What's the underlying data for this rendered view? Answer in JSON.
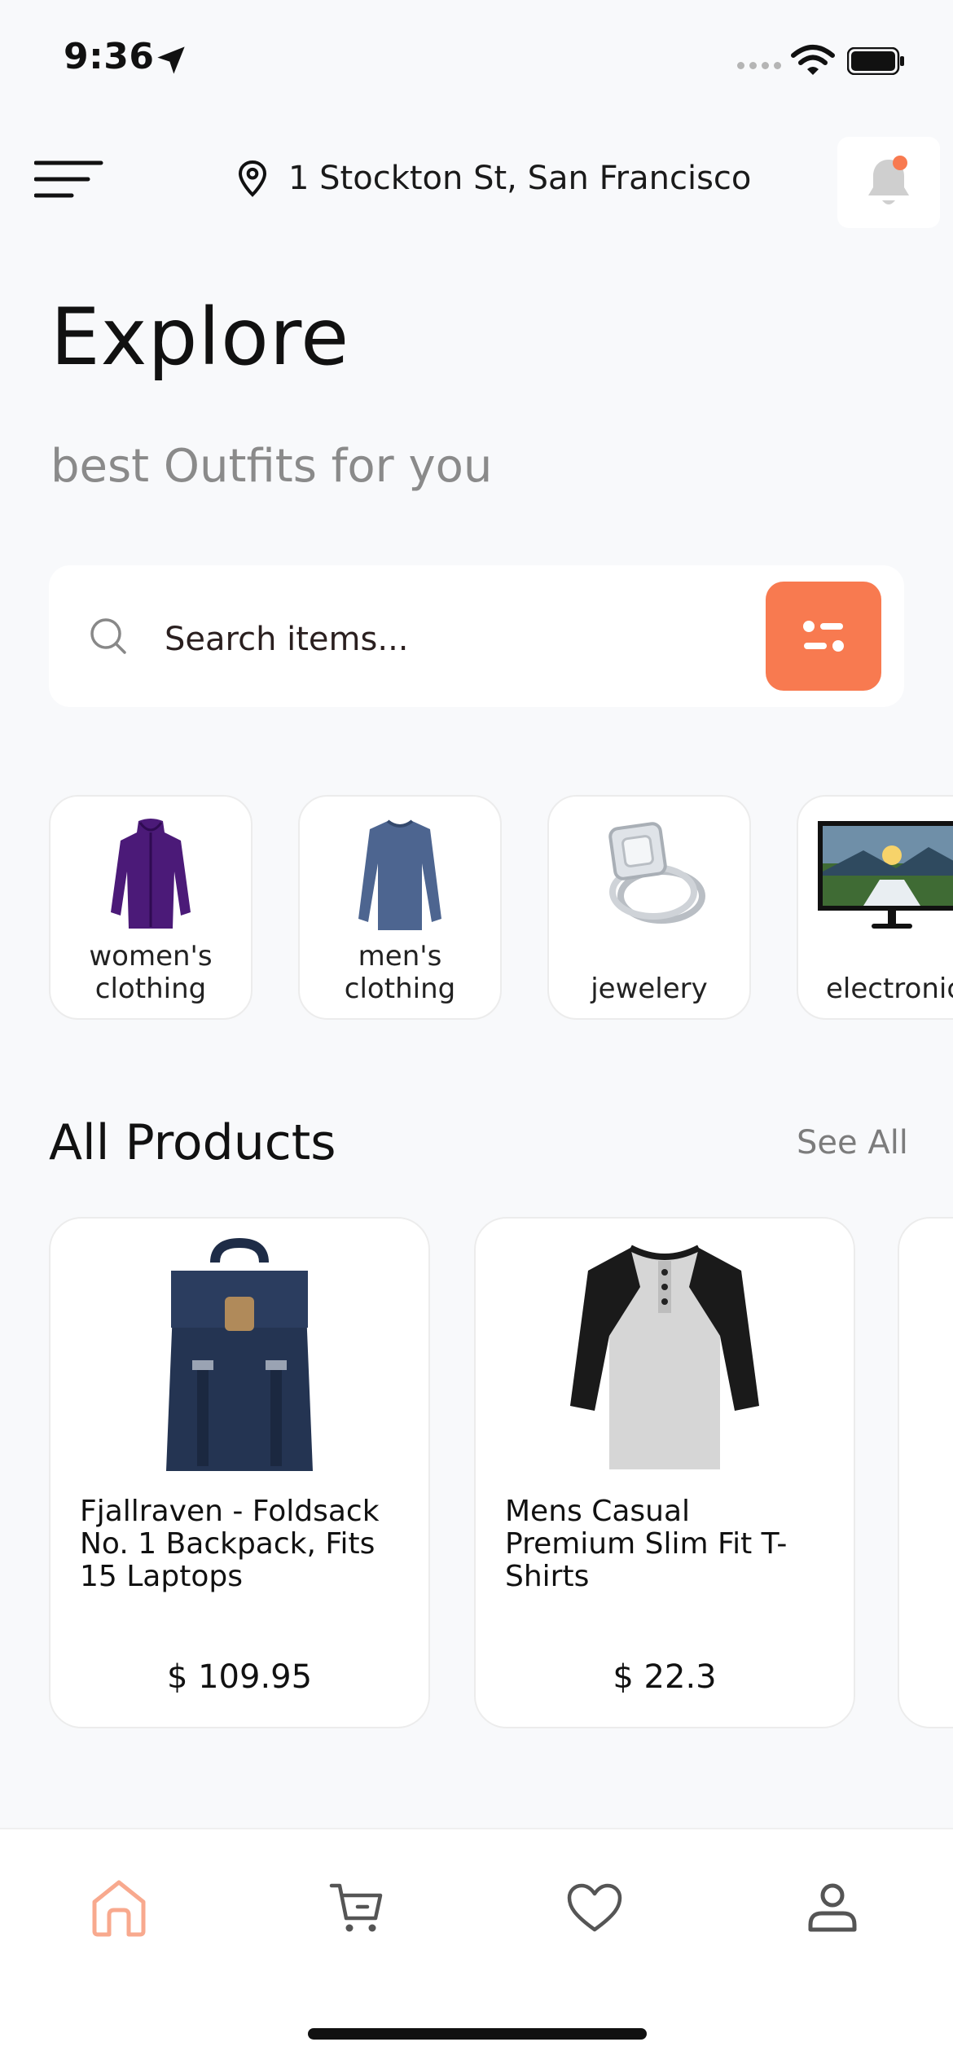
{
  "status_bar": {
    "time": "9:36"
  },
  "header": {
    "location": "1 Stockton St, San Francisco"
  },
  "page": {
    "title": "Explore",
    "subtitle": "best Outfits for you"
  },
  "search": {
    "placeholder": "Search items..."
  },
  "categories": [
    {
      "label": "women's clothing"
    },
    {
      "label": "men's clothing"
    },
    {
      "label": "jewelery"
    },
    {
      "label": "electronics"
    }
  ],
  "products_section": {
    "title": "All Products",
    "see_all": "See All",
    "items": [
      {
        "name": "Fjallraven - Foldsack No. 1 Backpack, Fits 15 Laptops",
        "price": "$ 109.95"
      },
      {
        "name": "Mens Casual Premium Slim Fit T-Shirts",
        "price": "$ 22.3"
      }
    ]
  },
  "nav": {
    "active": "home"
  },
  "colors": {
    "accent": "#f87a50",
    "background": "#f8f9fb",
    "muted_text": "#8a8a8a"
  },
  "icons": [
    "menu-icon",
    "location-pin-icon",
    "bell-icon",
    "search-icon",
    "filter-icon",
    "home-icon",
    "cart-icon",
    "heart-icon",
    "profile-icon"
  ]
}
